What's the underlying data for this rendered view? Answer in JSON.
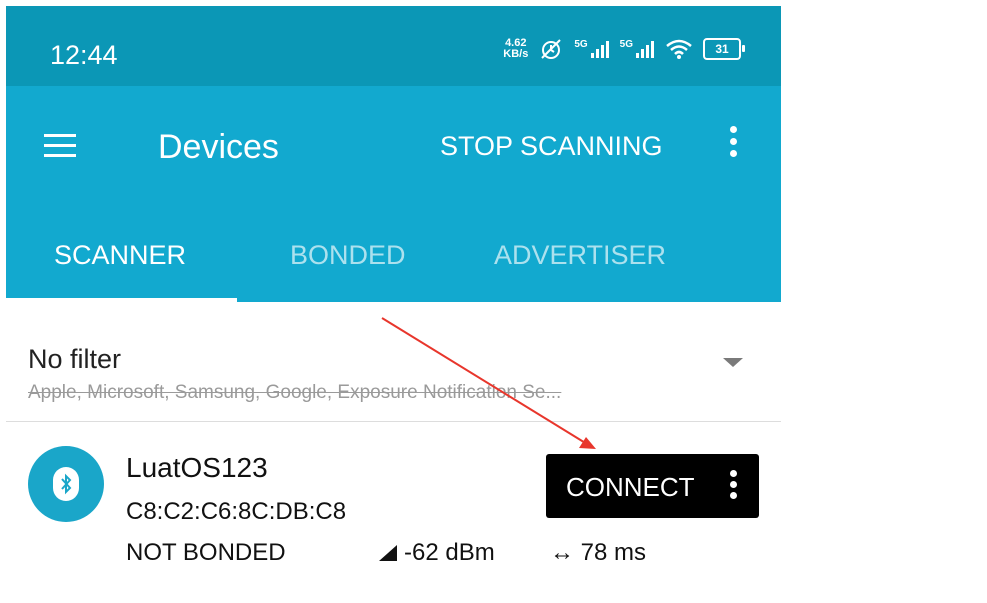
{
  "status_bar": {
    "time": "12:44",
    "net_speed_value": "4.62",
    "net_speed_unit": "KB/s",
    "sim1_label": "5G",
    "sim2_label": "5G",
    "battery_level": "31"
  },
  "app_bar": {
    "title": "Devices",
    "stop_scanning_label": "STOP SCANNING",
    "menu_icon": "hamburger-menu-icon",
    "overflow_icon": "vertical-dots-icon"
  },
  "tabs": [
    {
      "label": "SCANNER",
      "active": true
    },
    {
      "label": "BONDED",
      "active": false
    },
    {
      "label": "ADVERTISER",
      "active": false
    }
  ],
  "filter": {
    "title": "No filter",
    "subtitle": "Apple, Microsoft, Samsung, Google, Exposure Notification Se..."
  },
  "device": {
    "name": "LuatOS123",
    "mac": "C8:C2:C6:8C:DB:C8",
    "bond_state": "NOT BONDED",
    "rssi": "-62 dBm",
    "interval": "78 ms",
    "connect_label": "CONNECT",
    "icon": "bluetooth-icon"
  },
  "colors": {
    "status_bar": "#0b97b6",
    "app_bar": "#12a9cf",
    "annotation_arrow": "#e8362c"
  }
}
